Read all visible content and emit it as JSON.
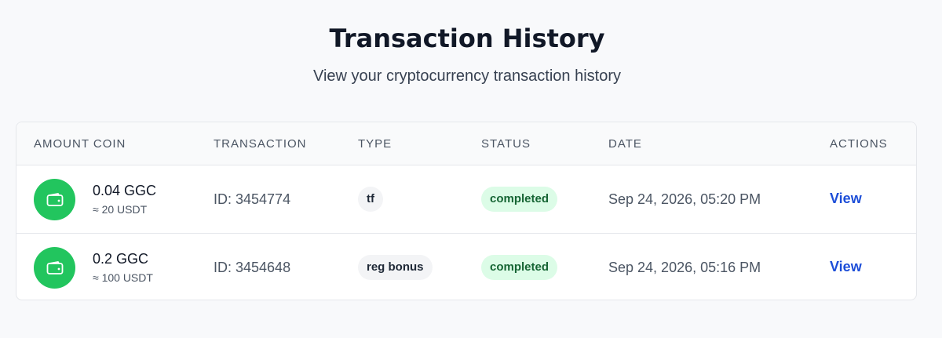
{
  "header": {
    "title": "Transaction History",
    "subtitle": "View your cryptocurrency transaction history"
  },
  "table": {
    "columns": [
      "AMOUNT COIN",
      "TRANSACTION",
      "TYPE",
      "STATUS",
      "DATE",
      "ACTIONS"
    ],
    "rows": [
      {
        "icon": "wallet-icon",
        "amount": "0.04 GGC",
        "usd": "≈ 20 USDT",
        "transaction": "ID: 3454774",
        "type": "tf",
        "status": "completed",
        "date": "Sep 24, 2026, 05:20 PM",
        "action": "View"
      },
      {
        "icon": "wallet-icon",
        "amount": "0.2 GGC",
        "usd": "≈ 100 USDT",
        "transaction": "ID: 3454648",
        "type": "reg bonus",
        "status": "completed",
        "date": "Sep 24, 2026, 05:16 PM",
        "action": "View"
      }
    ]
  },
  "colors": {
    "page_background": "#f8f9fb",
    "coin_icon": "#22c55e",
    "status_completed_bg": "#dcfce7",
    "status_completed_text": "#166534",
    "link": "#1d4ed8"
  }
}
